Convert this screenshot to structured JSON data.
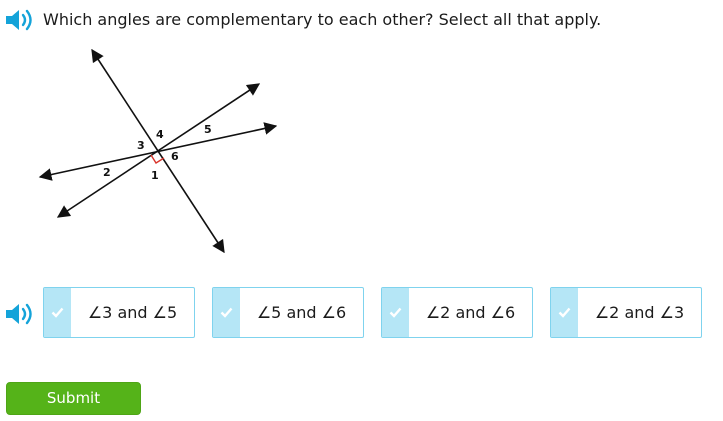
{
  "question": {
    "text": "Which angles are complementary to each other? Select all that apply.",
    "speaker_icon": "speaker-icon"
  },
  "diagram": {
    "angle_labels": [
      "1",
      "2",
      "3",
      "4",
      "5",
      "6"
    ],
    "right_angle_mark_color": "#d9342b"
  },
  "choices": {
    "speaker_icon": "speaker-icon",
    "options": [
      {
        "label": "∠3 and ∠5"
      },
      {
        "label": "∠5 and ∠6"
      },
      {
        "label": "∠2 and ∠6"
      },
      {
        "label": "∠2 and ∠3"
      }
    ]
  },
  "submit": {
    "label": "Submit"
  },
  "colors": {
    "accent": "#14a3d9",
    "choice_border": "#7fd3ee",
    "check_strip": "#b5e6f6",
    "submit_green": "#55b319"
  }
}
